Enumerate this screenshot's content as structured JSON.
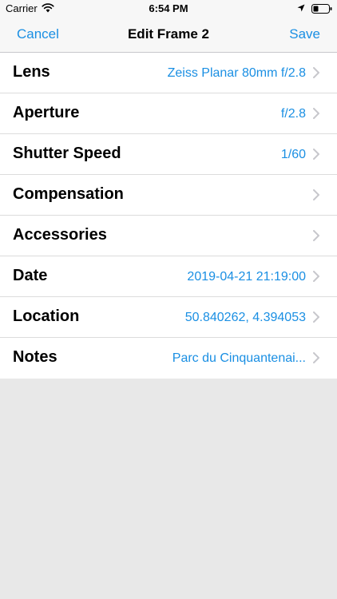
{
  "status_bar": {
    "carrier": "Carrier",
    "time": "6:54 PM",
    "icons": [
      "wifi-icon",
      "location-arrow-icon",
      "battery-icon"
    ]
  },
  "nav": {
    "left_button": "Cancel",
    "title": "Edit Frame 2",
    "right_button": "Save"
  },
  "rows": [
    {
      "label": "Lens",
      "value": "Zeiss Planar 80mm f/2.8"
    },
    {
      "label": "Aperture",
      "value": "f/2.8"
    },
    {
      "label": "Shutter Speed",
      "value": "1/60"
    },
    {
      "label": "Compensation",
      "value": ""
    },
    {
      "label": "Accessories",
      "value": ""
    },
    {
      "label": "Date",
      "value": "2019-04-21 21:19:00"
    },
    {
      "label": "Location",
      "value": "50.840262, 4.394053"
    },
    {
      "label": "Notes",
      "value": "Parc du Cinquantenai..."
    }
  ],
  "colors": {
    "accent": "#1a8fe3",
    "background": "#e8e8e8",
    "bar": "#f7f7f7"
  }
}
